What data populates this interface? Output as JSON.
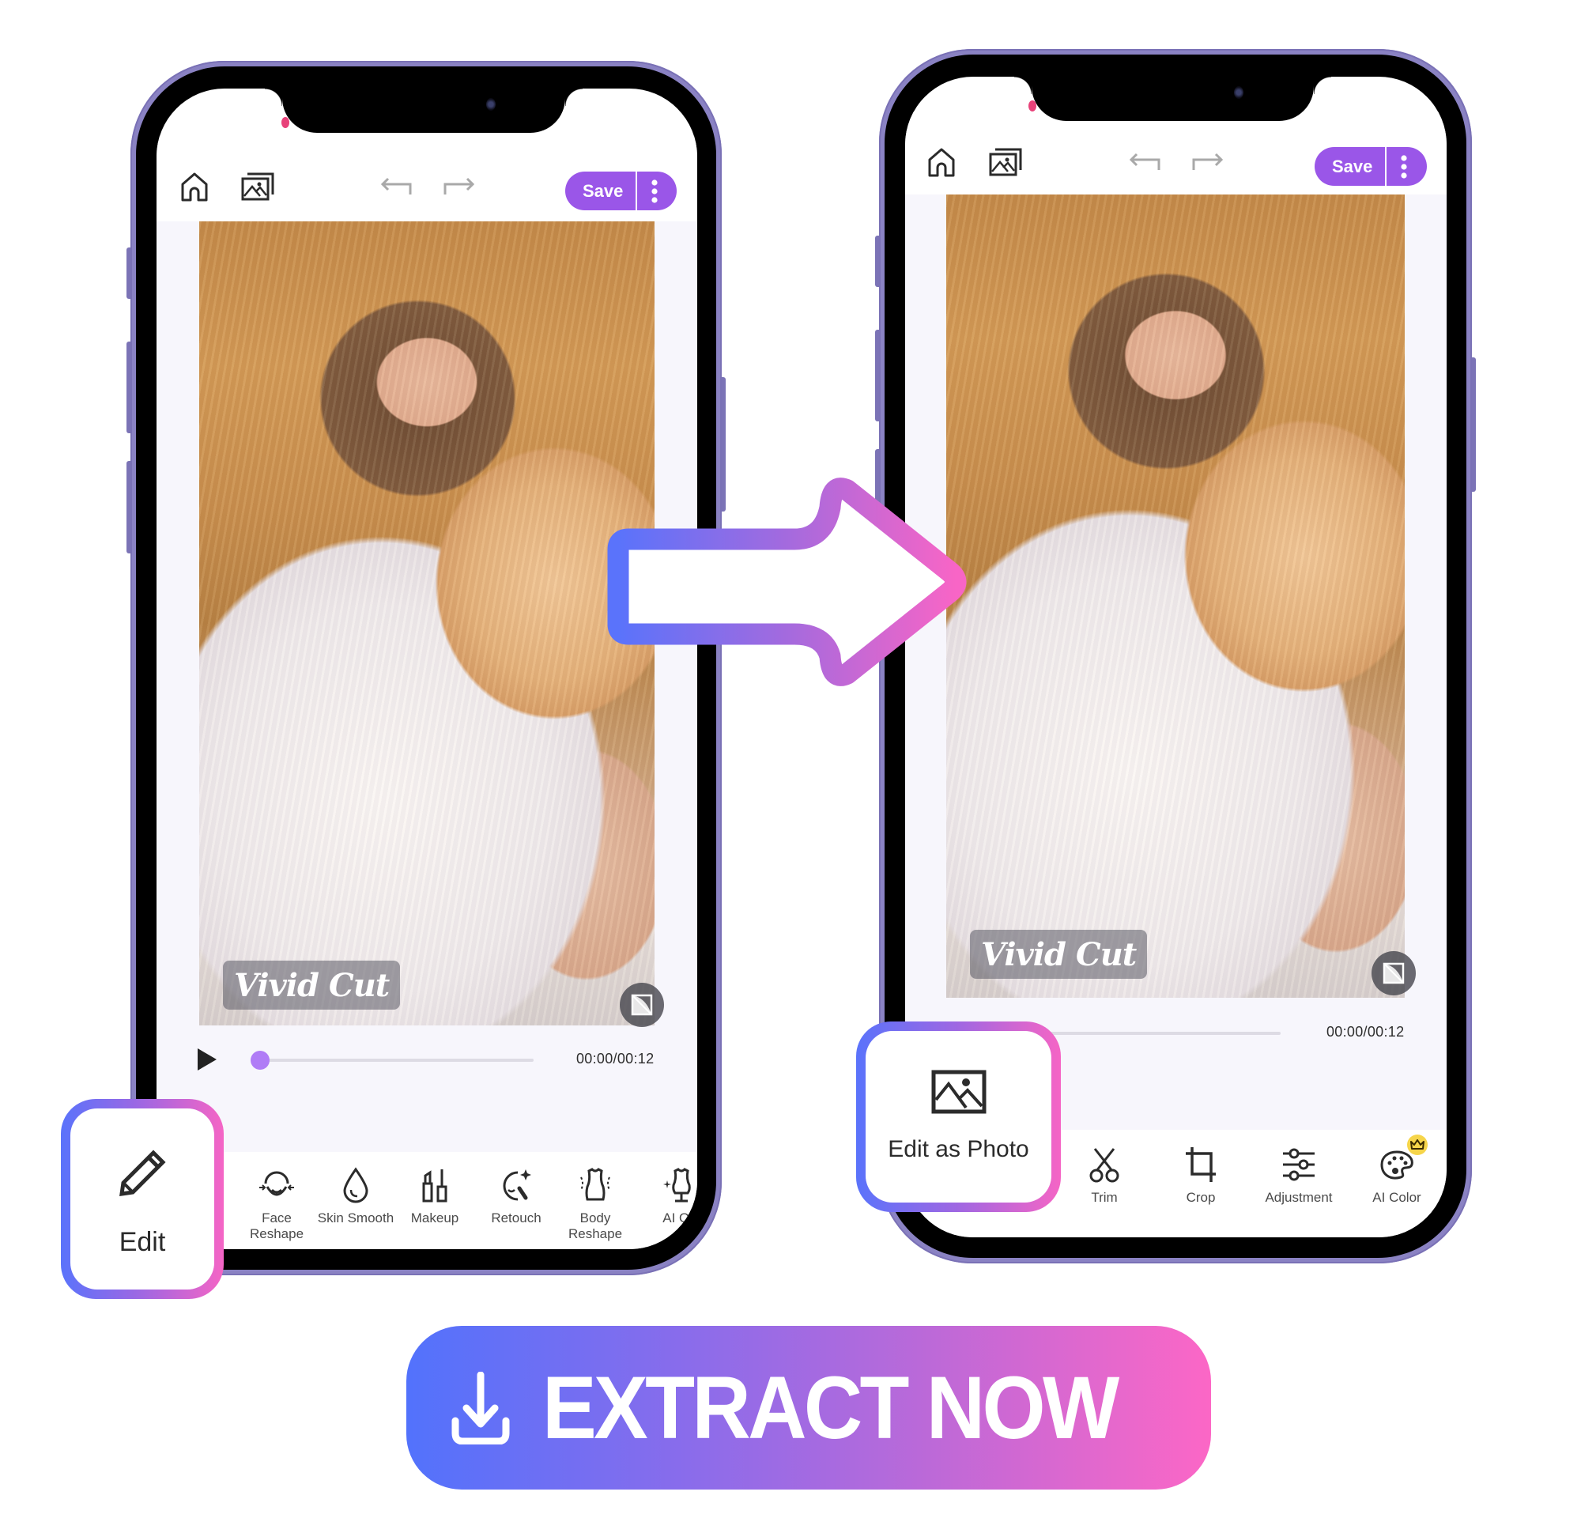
{
  "colors": {
    "accent_purple": "#9a56e8",
    "frame_purple": "#8a82c3",
    "gradient_start": "#5272fc",
    "gradient_end": "#fc67c6",
    "knob": "#b07cf6",
    "crown_badge": "#f6d54a"
  },
  "left_phone": {
    "header": {
      "home_icon": "home-icon",
      "gallery_icon": "gallery-icon",
      "undo_icon": "undo-icon",
      "redo_icon": "redo-icon",
      "save_label": "Save",
      "more_icon": "more-vertical-icon"
    },
    "preview": {
      "watermark": "Vivid Cut",
      "compare_icon": "compare-icon"
    },
    "timeline": {
      "play_icon": "play-icon",
      "progress": 0.0,
      "time": "00:00/00:12"
    },
    "toolbar": {
      "items": [
        {
          "label": "Face\nReshape",
          "icon": "face-reshape-icon"
        },
        {
          "label": "Skin Smooth",
          "icon": "skin-smooth-icon"
        },
        {
          "label": "Makeup",
          "icon": "makeup-icon"
        },
        {
          "label": "Retouch",
          "icon": "retouch-icon"
        },
        {
          "label": "Body\nReshape",
          "icon": "body-reshape-icon"
        },
        {
          "label": "AI Ou",
          "icon": "ai-outfit-icon"
        }
      ]
    },
    "callout": {
      "label": "Edit",
      "icon": "pencil-icon"
    }
  },
  "right_phone": {
    "header": {
      "home_icon": "home-icon",
      "gallery_icon": "gallery-icon",
      "undo_icon": "undo-icon",
      "redo_icon": "redo-icon",
      "save_label": "Save",
      "more_icon": "more-vertical-icon"
    },
    "preview": {
      "watermark": "Vivid Cut",
      "compare_icon": "compare-icon"
    },
    "timeline": {
      "time": "00:00/00:12"
    },
    "toolbar": {
      "items": [
        {
          "label": "Trim",
          "icon": "scissors-icon"
        },
        {
          "label": "Crop",
          "icon": "crop-icon"
        },
        {
          "label": "Adjustment",
          "icon": "sliders-icon"
        },
        {
          "label": "AI Color",
          "icon": "palette-icon",
          "badge": "crown-icon"
        }
      ]
    },
    "callout": {
      "label": "Edit as Photo",
      "icon": "image-icon"
    }
  },
  "transition_arrow": "arrow-right-icon",
  "cta": {
    "label": "EXTRACT NOW",
    "icon": "download-icon"
  }
}
